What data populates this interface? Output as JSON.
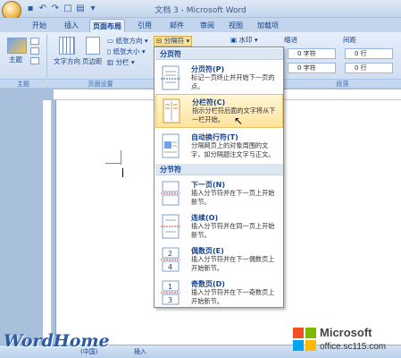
{
  "window": {
    "title": "文档 3 - Microsoft Word"
  },
  "tabs": [
    "开始",
    "插入",
    "页面布局",
    "引用",
    "邮件",
    "审阅",
    "视图",
    "加载项"
  ],
  "ribbon": {
    "themes_label": "主题",
    "text_direction": "文字方向",
    "margins": "页边距",
    "orientation": "纸张方向 ▾",
    "size": "纸张大小 ▾",
    "columns": "分栏 ▾",
    "breaks": "分隔符 ▾",
    "watermark": "水印 ▾",
    "indent": "缩进",
    "spacing": "间距",
    "indent_left": "0 字符",
    "indent_right": "0 字符",
    "spacing_before": "0 行",
    "spacing_after": "0 行",
    "group_themes": "主题",
    "group_page_setup": "页面设置",
    "group_paragraph": "段落"
  },
  "dropdown": {
    "section1": "分页符",
    "section2": "分节符",
    "items": [
      {
        "title": "分页符(P)",
        "desc": "标记一页终止并开始下一页的点。"
      },
      {
        "title": "分栏符(C)",
        "desc": "指示分栏符后面的文字将从下一栏开始。"
      },
      {
        "title": "自动换行符(T)",
        "desc": "分隔网页上的对象周围的文字，如分隔题注文字与正文。"
      },
      {
        "title": "下一页(N)",
        "desc": "插入分节符并在下一页上开始新节。"
      },
      {
        "title": "连续(O)",
        "desc": "插入分节符并在同一页上开始新节。"
      },
      {
        "title": "偶数页(E)",
        "desc": "插入分节符并在下一偶数页上开始新节。"
      },
      {
        "title": "奇数页(D)",
        "desc": "插入分节符并在下一奇数页上开始新节。"
      }
    ]
  },
  "status": {
    "lang": "(中国)",
    "mode": "插入"
  },
  "watermark_text": "WordHome",
  "logo": {
    "brand": "Microsoft",
    "site": "office.sc115.com"
  }
}
